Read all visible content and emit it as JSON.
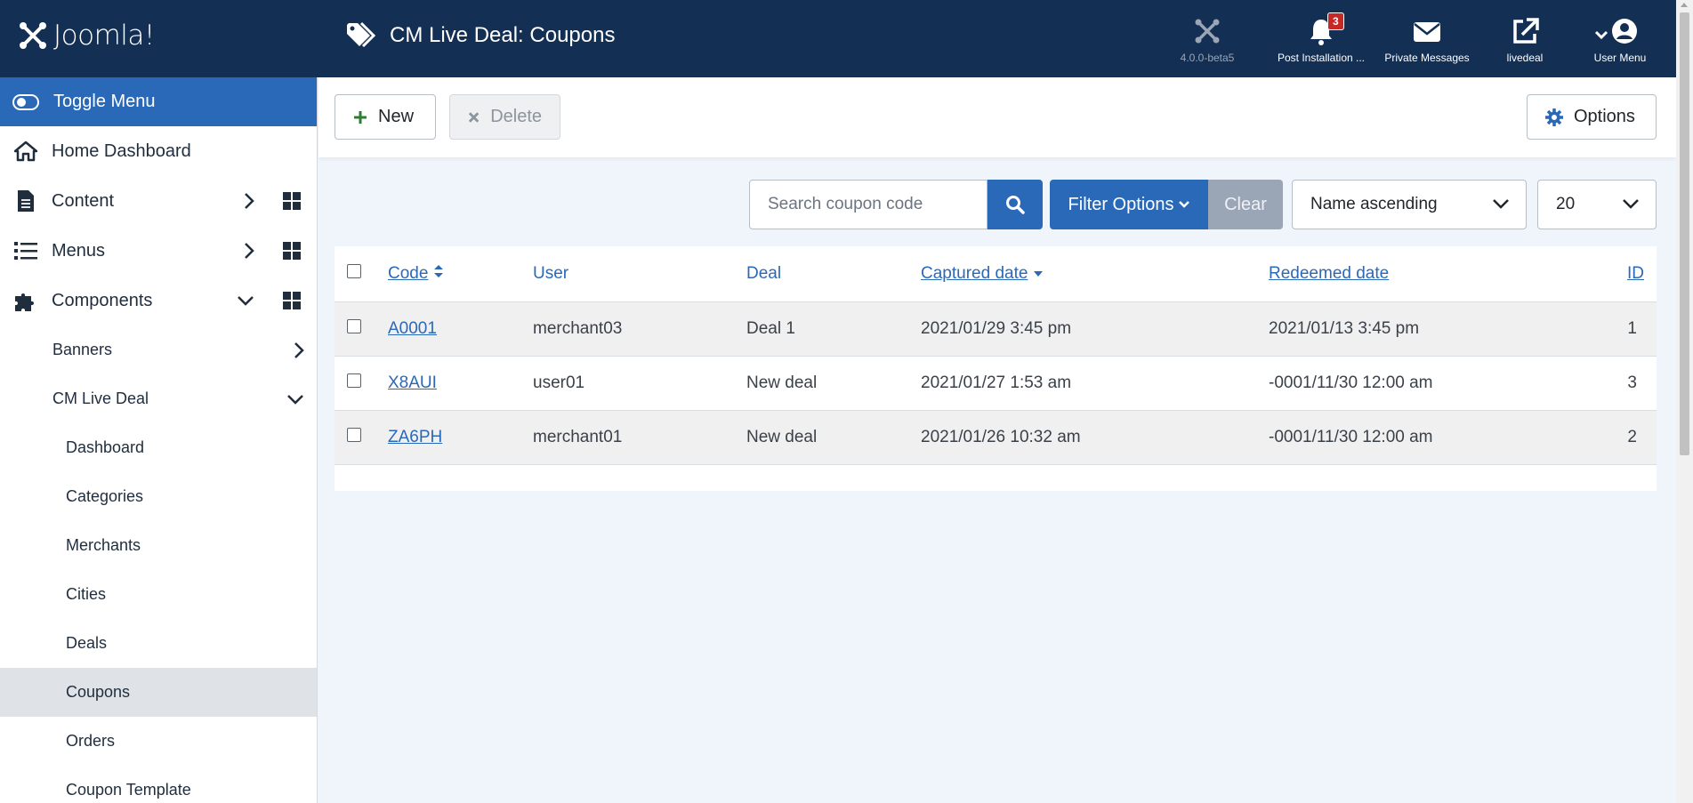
{
  "header": {
    "logo_text": "Joomla!",
    "title": "CM Live Deal: Coupons",
    "version_label": "4.0.0-beta5",
    "post_install_label": "Post Installation ...",
    "post_install_count": "3",
    "messages_label": "Private Messages",
    "site_label": "livedeal",
    "user_menu_label": "User Menu"
  },
  "sidebar": {
    "toggle_label": "Toggle Menu",
    "items": [
      {
        "label": "Home Dashboard"
      },
      {
        "label": "Content"
      },
      {
        "label": "Menus"
      },
      {
        "label": "Components"
      }
    ],
    "sub_items": [
      {
        "label": "Banners"
      },
      {
        "label": "CM Live Deal"
      }
    ],
    "sub2_items": [
      {
        "label": "Dashboard"
      },
      {
        "label": "Categories"
      },
      {
        "label": "Merchants"
      },
      {
        "label": "Cities"
      },
      {
        "label": "Deals"
      },
      {
        "label": "Coupons"
      },
      {
        "label": "Orders"
      },
      {
        "label": "Coupon Template"
      }
    ]
  },
  "toolbar": {
    "new_label": "New",
    "delete_label": "Delete",
    "options_label": "Options"
  },
  "filters": {
    "search_placeholder": "Search coupon code",
    "filter_options_label": "Filter Options",
    "clear_label": "Clear",
    "sort_value": "Name ascending",
    "limit_value": "20"
  },
  "table": {
    "headers": {
      "code": "Code",
      "user": "User",
      "deal": "Deal",
      "captured": "Captured date",
      "redeemed": "Redeemed date",
      "id": "ID"
    },
    "rows": [
      {
        "code": "A0001",
        "user": "merchant03",
        "deal": "Deal 1",
        "captured": "2021/01/29 3:45 pm",
        "redeemed": "2021/01/13 3:45 pm",
        "id": "1"
      },
      {
        "code": "X8AUI",
        "user": "user01",
        "deal": "New deal",
        "captured": "2021/01/27 1:53 am",
        "redeemed": "-0001/11/30 12:00 am",
        "id": "3"
      },
      {
        "code": "ZA6PH",
        "user": "merchant01",
        "deal": "New deal",
        "captured": "2021/01/26 10:32 am",
        "redeemed": "-0001/11/30 12:00 am",
        "id": "2"
      }
    ]
  },
  "colors": {
    "header_bg": "#132f53",
    "accent": "#2a69b8",
    "badge": "#c52827"
  }
}
